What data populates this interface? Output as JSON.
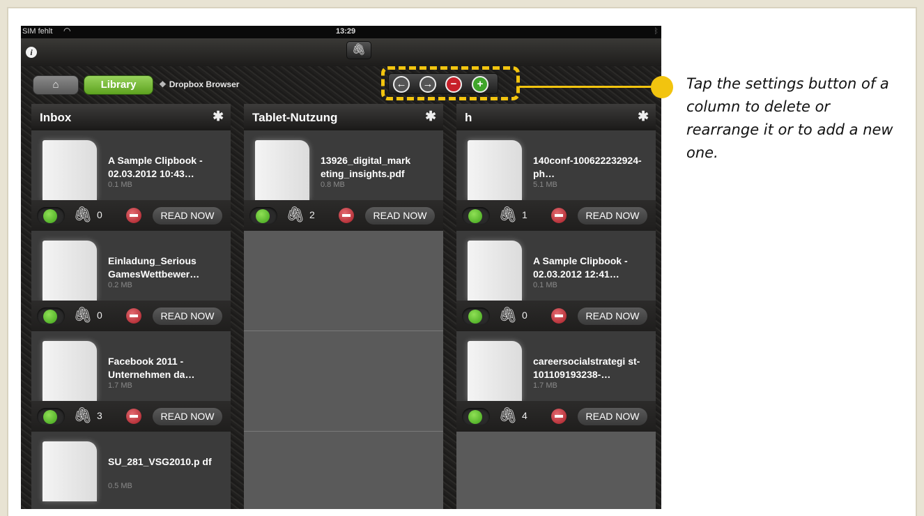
{
  "status_bar": {
    "carrier": "SIM fehlt",
    "time": "13:29"
  },
  "nav": {
    "home_icon": "⌂",
    "library_label": "Library",
    "dropbox_label": "Dropbox Browser"
  },
  "controls": {
    "back_icon": "←",
    "forward_icon": "→",
    "delete_icon": "−",
    "add_icon": "+"
  },
  "read_now_label": "READ NOW",
  "columns": [
    {
      "title": "Inbox",
      "items": [
        {
          "title": "A Sample Clipbook - 02.03.2012 10:43…",
          "size": "0.1 MB",
          "attachments": "0"
        },
        {
          "title": "Einladung_Serious GamesWettbewer…",
          "size": "0.2 MB",
          "attachments": "0"
        },
        {
          "title": "Facebook 2011 - Unternehmen da…",
          "size": "1.7 MB",
          "attachments": "3"
        },
        {
          "title": "SU_281_VSG2010.p df",
          "size": "0.5 MB"
        }
      ]
    },
    {
      "title": "Tablet-Nutzung",
      "items": [
        {
          "title": "13926_digital_mark eting_insights.pdf",
          "size": "0.8 MB",
          "attachments": "2"
        }
      ]
    },
    {
      "title": "h",
      "items": [
        {
          "title": "140conf-100622232924-ph…",
          "size": "5.1 MB",
          "attachments": "1"
        },
        {
          "title": "A Sample Clipbook - 02.03.2012 12:41…",
          "size": "0.1 MB",
          "attachments": "0"
        },
        {
          "title": "careersocialstrategi st-101109193238-…",
          "size": "1.7 MB",
          "attachments": "4"
        }
      ]
    }
  ],
  "callout": "Tap the settings button of a column to  delete or rearrange it or to add a new one.",
  "colors": {
    "highlight": "#f2c40f",
    "library_green": "#6ab42a"
  }
}
